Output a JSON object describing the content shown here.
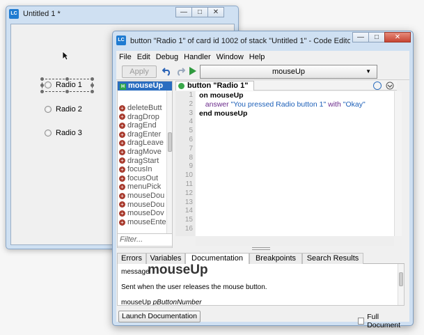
{
  "stack_window": {
    "title": "Untitled 1 *",
    "icon_text": "LC",
    "window_buttons": {
      "minimize": "—",
      "maximize": "□",
      "close": "✕"
    },
    "radios": [
      {
        "label": "Radio 1",
        "selected_in_editor": true
      },
      {
        "label": "Radio 2"
      },
      {
        "label": "Radio 3"
      }
    ]
  },
  "editor_window": {
    "title": "button \"Radio 1\" of card id 1002 of stack \"Untitled 1\" - Code Editor (editin...",
    "icon_text": "LC",
    "window_buttons": {
      "minimize": "—",
      "maximize": "□",
      "close": "✕"
    },
    "menu": [
      "File",
      "Edit",
      "Debug",
      "Handler",
      "Window",
      "Help"
    ],
    "toolbar": {
      "apply_label": "Apply",
      "undo_icon": "undo-icon",
      "redo_icon": "redo-icon",
      "run_icon": "run-icon",
      "handler_select_value": "mouseUp"
    },
    "handlers": {
      "active": "mouseUp",
      "active_badge": "H",
      "list": [
        "deleteButt",
        "dragDrop",
        "dragEnd",
        "dragEnter",
        "dragLeave",
        "dragMove",
        "dragStart",
        "focusIn",
        "focusOut",
        "menuPick",
        "mouseDou",
        "mouseDou",
        "mouseDov",
        "mouseEnte"
      ],
      "filter_placeholder": "Filter..."
    },
    "script_tab": "button \"Radio 1\"",
    "line_numbers": [
      "1",
      "2",
      "3",
      "4",
      "5",
      "6",
      "7",
      "8",
      "9",
      "10",
      "11",
      "12",
      "13",
      "14",
      "15",
      "16"
    ],
    "code": {
      "line1_kw": "on",
      "line1_name": " mouseUp",
      "line2_cmd": "answer",
      "line2_str": " \"You pressed Radio button 1\"",
      "line2_with": " with",
      "line2_str2": " \"Okay\"",
      "line3_kw": "end",
      "line3_name": " mouseUp"
    },
    "bottom_tabs": [
      "Errors",
      "Variables",
      "Documentation",
      "Breakpoints",
      "Search Results"
    ],
    "active_bottom_tab": "Documentation",
    "documentation": {
      "type": "message",
      "name": "mouseUp",
      "summary": "Sent when the user releases the mouse button.",
      "syntax_name": "mouseUp",
      "syntax_param": "pButtonNumber"
    },
    "launch_button_label": "Launch Documentation",
    "full_document_label": "Full Document"
  }
}
